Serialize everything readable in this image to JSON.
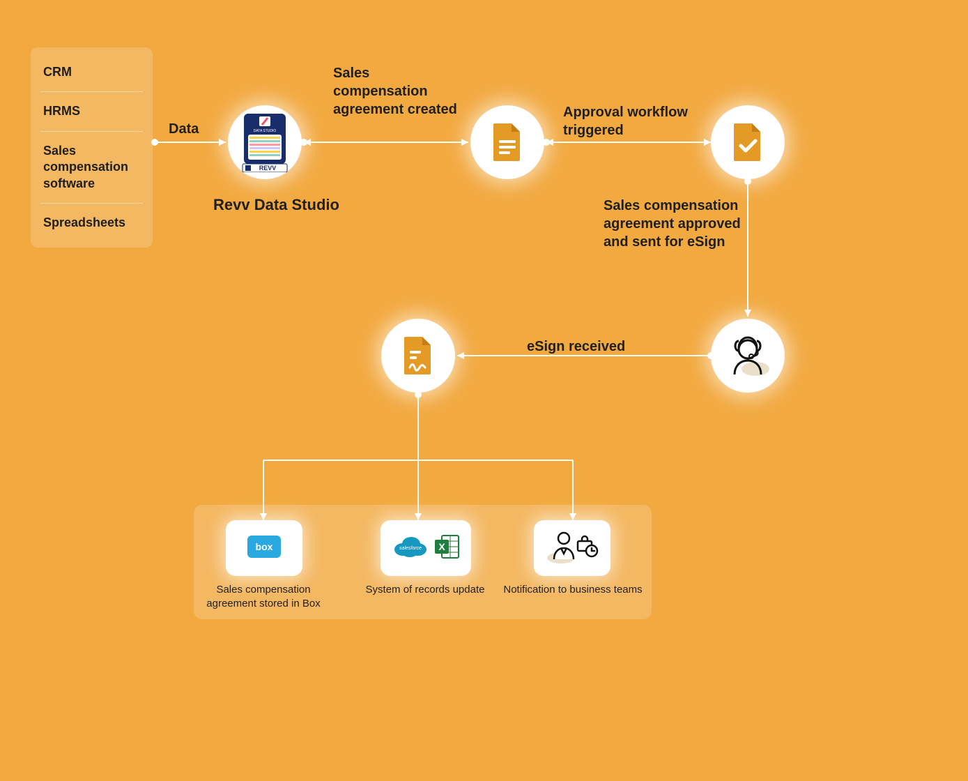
{
  "sources": {
    "items": [
      "CRM",
      "HRMS",
      "Sales compensation software",
      "Spreadsheets"
    ]
  },
  "labels": {
    "data": "Data",
    "revv": "Revv Data Studio",
    "created": "Sales compensation agreement created",
    "approval": "Approval workflow triggered",
    "approvedSent": "Sales compensation agreement approved and sent for eSign",
    "esignReceived": "eSign received"
  },
  "outputs": {
    "items": [
      "Sales compensation agreement stored in Box",
      "System of records update",
      "Notification to business teams"
    ]
  },
  "icons": {
    "revvBrand": "REVV",
    "revvDataStudio": "DATA STUDIO",
    "boxBrand": "box",
    "salesforceBrand": "salesforce",
    "excelBrand": "X"
  },
  "colors": {
    "bg": "#f2a940",
    "accent": "#e39b25",
    "ink": "#1f1f1f"
  }
}
